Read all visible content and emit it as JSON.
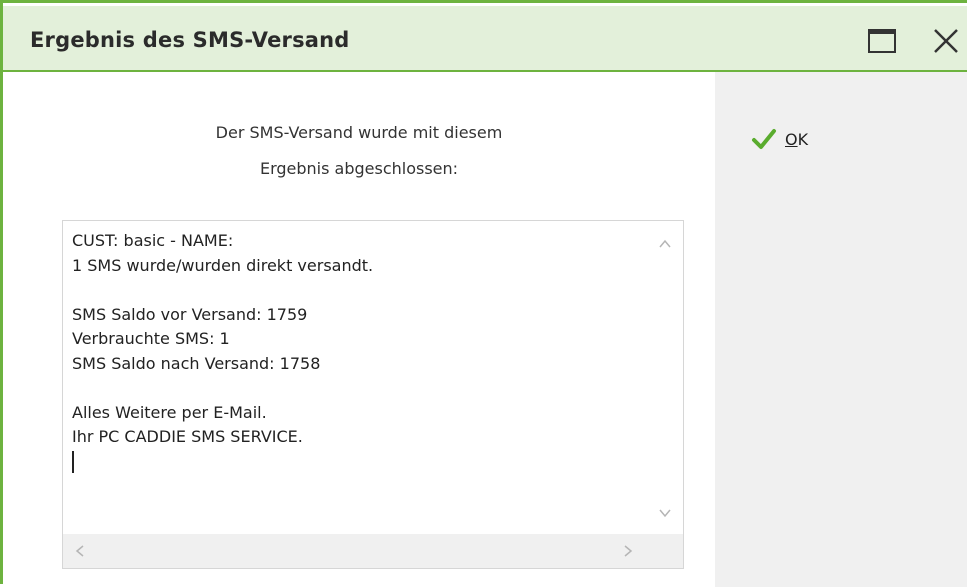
{
  "dialog": {
    "title": "Ergebnis des SMS-Versand",
    "icons": {
      "maximize": "maximize-icon",
      "close": "close-icon"
    },
    "accent_color": "#6db33f",
    "titlebar_color": "#e3f0da"
  },
  "message": {
    "line1": "Der SMS-Versand wurde mit diesem",
    "line2": "Ergebnis abgeschlossen:"
  },
  "result_text": {
    "lines": [
      "CUST: basic - NAME:",
      "1 SMS wurde/wurden direkt versandt.",
      "",
      "SMS Saldo vor Versand: 1759",
      "Verbrauchte SMS: 1",
      "SMS Saldo nach Versand: 1758",
      "",
      "Alles Weitere per E-Mail.",
      "Ihr PC CADDIE SMS SERVICE."
    ]
  },
  "actions": {
    "ok": {
      "underlined": "O",
      "rest": "K",
      "icon": "checkmark-icon",
      "icon_color": "#5aac2e"
    }
  },
  "scrollbars": {
    "icons": [
      "scroll-up-icon",
      "scroll-down-icon",
      "scroll-left-icon",
      "scroll-right-icon"
    ]
  }
}
